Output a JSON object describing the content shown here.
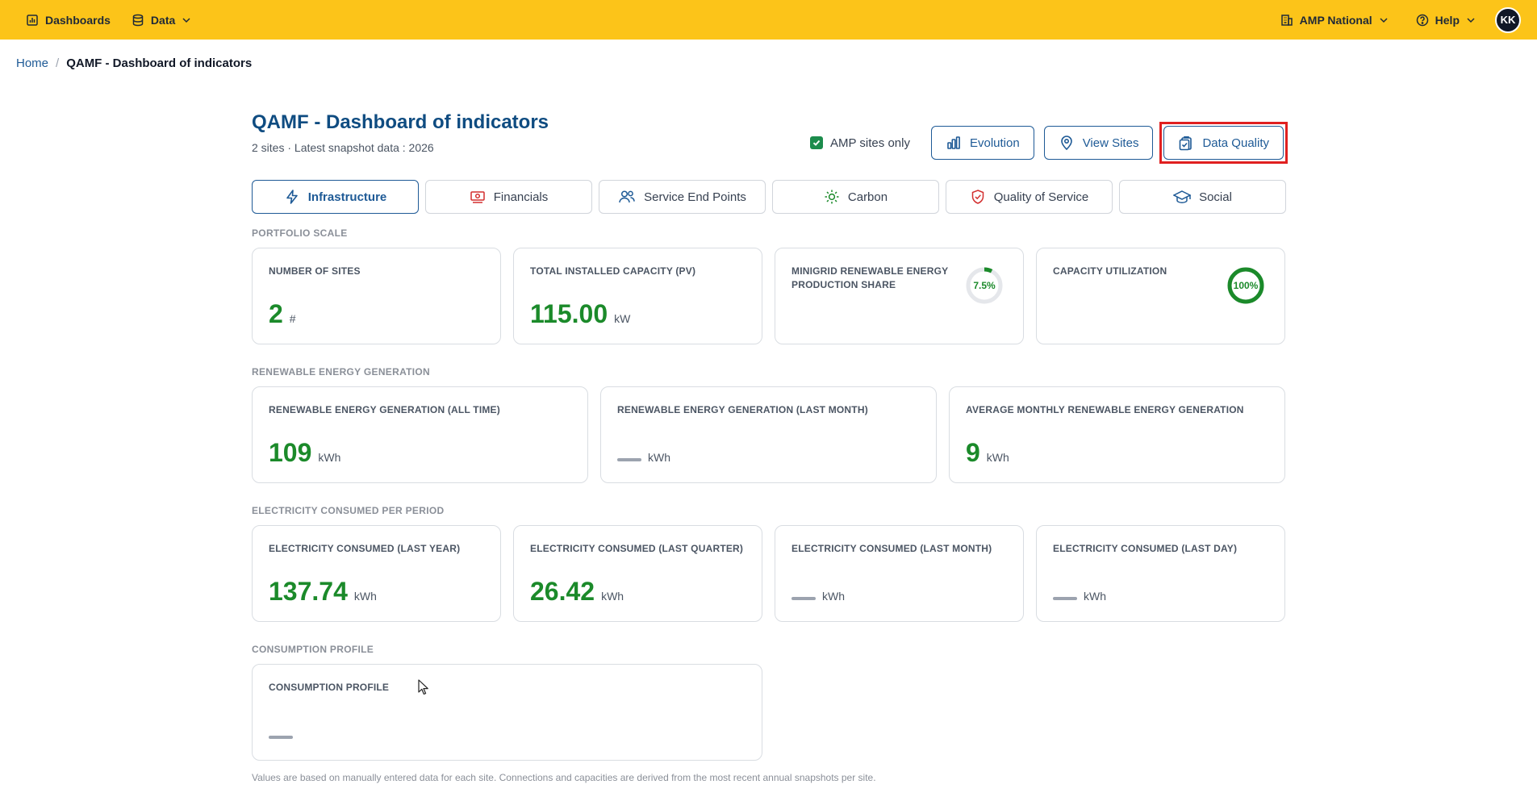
{
  "topbar": {
    "dashboards_label": "Dashboards",
    "data_label": "Data",
    "org_label": "AMP National",
    "help_label": "Help",
    "avatar_initials": "KK"
  },
  "breadcrumb": {
    "home": "Home",
    "separator": "/",
    "current": "QAMF - Dashboard of indicators"
  },
  "header": {
    "title": "QAMF - Dashboard of indicators",
    "subtitle": "2 sites · Latest snapshot data : 2026",
    "amp_sites_only_label": "AMP sites only",
    "amp_sites_only_checked": true,
    "evolution_label": "Evolution",
    "view_sites_label": "View Sites",
    "data_quality_label": "Data Quality"
  },
  "tabs": [
    {
      "label": "Infrastructure",
      "icon": "bolt-icon",
      "active": true
    },
    {
      "label": "Financials",
      "icon": "money-icon",
      "active": false
    },
    {
      "label": "Service End Points",
      "icon": "users-icon",
      "active": false
    },
    {
      "label": "Carbon",
      "icon": "sun-icon",
      "active": false
    },
    {
      "label": "Quality of Service",
      "icon": "shield-check-icon",
      "active": false
    },
    {
      "label": "Social",
      "icon": "graduation-cap-icon",
      "active": false
    }
  ],
  "sections": {
    "portfolio": {
      "label": "PORTFOLIO SCALE",
      "cards": {
        "sites": {
          "label": "NUMBER OF SITES",
          "value": "2",
          "unit": "#"
        },
        "capacity": {
          "label": "TOTAL INSTALLED CAPACITY (PV)",
          "value": "115.00",
          "unit": "kW"
        },
        "renewable_share": {
          "label": "MINIGRID RENEWABLE ENERGY PRODUCTION SHARE",
          "ring_text": "7.5%",
          "ring_fraction": 0.075
        },
        "utilization": {
          "label": "CAPACITY UTILIZATION",
          "ring_text": "100%",
          "ring_fraction": 1.0
        }
      }
    },
    "generation": {
      "label": "RENEWABLE ENERGY GENERATION",
      "cards": {
        "all_time": {
          "label": "RENEWABLE ENERGY GENERATION (ALL TIME)",
          "value": "109",
          "unit": "kWh"
        },
        "last_month": {
          "label": "RENEWABLE ENERGY GENERATION (LAST MONTH)",
          "unit": "kWh"
        },
        "avg_monthly": {
          "label": "AVERAGE MONTHLY RENEWABLE ENERGY GENERATION",
          "value": "9",
          "unit": "kWh"
        }
      }
    },
    "consumed": {
      "label": "ELECTRICITY CONSUMED PER PERIOD",
      "cards": {
        "last_year": {
          "label": "ELECTRICITY CONSUMED (LAST YEAR)",
          "value": "137.74",
          "unit": "kWh"
        },
        "last_quarter": {
          "label": "ELECTRICITY CONSUMED (LAST QUARTER)",
          "value": "26.42",
          "unit": "kWh"
        },
        "last_month": {
          "label": "ELECTRICITY CONSUMED (LAST MONTH)",
          "unit": "kWh"
        },
        "last_day": {
          "label": "ELECTRICITY CONSUMED (LAST DAY)",
          "unit": "kWh"
        }
      }
    },
    "profile": {
      "label": "CONSUMPTION PROFILE",
      "cards": {
        "profile": {
          "label": "CONSUMPTION PROFILE"
        }
      }
    }
  },
  "footnote": "Values are based on manually entered data for each site. Connections and capacities are derived from the most recent annual snapshots per site.",
  "colors": {
    "topbar": "#fcc419",
    "brand_blue": "#1e5a96",
    "value_green": "#1b8a2a",
    "highlight_red": "#e02020"
  }
}
